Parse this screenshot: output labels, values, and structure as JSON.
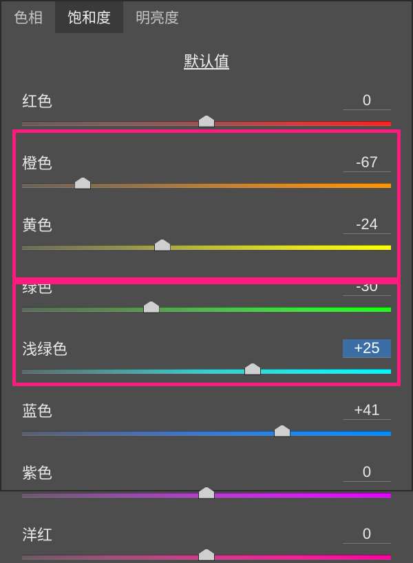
{
  "tabs": {
    "hue": "色相",
    "saturation": "饱和度",
    "luminance": "明亮度",
    "active": "saturation"
  },
  "title": "默认值",
  "sliders": [
    {
      "id": "red",
      "label": "红色",
      "value": "0",
      "pos": 50
    },
    {
      "id": "orange",
      "label": "橙色",
      "value": "-67",
      "pos": 16.5
    },
    {
      "id": "yellow",
      "label": "黄色",
      "value": "-24",
      "pos": 38
    },
    {
      "id": "green",
      "label": "绿色",
      "value": "-30",
      "pos": 35
    },
    {
      "id": "aqua",
      "label": "浅绿色",
      "value": "+25",
      "pos": 62.5,
      "selected": true
    },
    {
      "id": "blue",
      "label": "蓝色",
      "value": "+41",
      "pos": 70.5
    },
    {
      "id": "purple",
      "label": "紫色",
      "value": "0",
      "pos": 50
    },
    {
      "id": "magenta",
      "label": "洋红",
      "value": "0",
      "pos": 50
    }
  ],
  "highlights": [
    "orange-yellow-green",
    "aqua-blue"
  ]
}
